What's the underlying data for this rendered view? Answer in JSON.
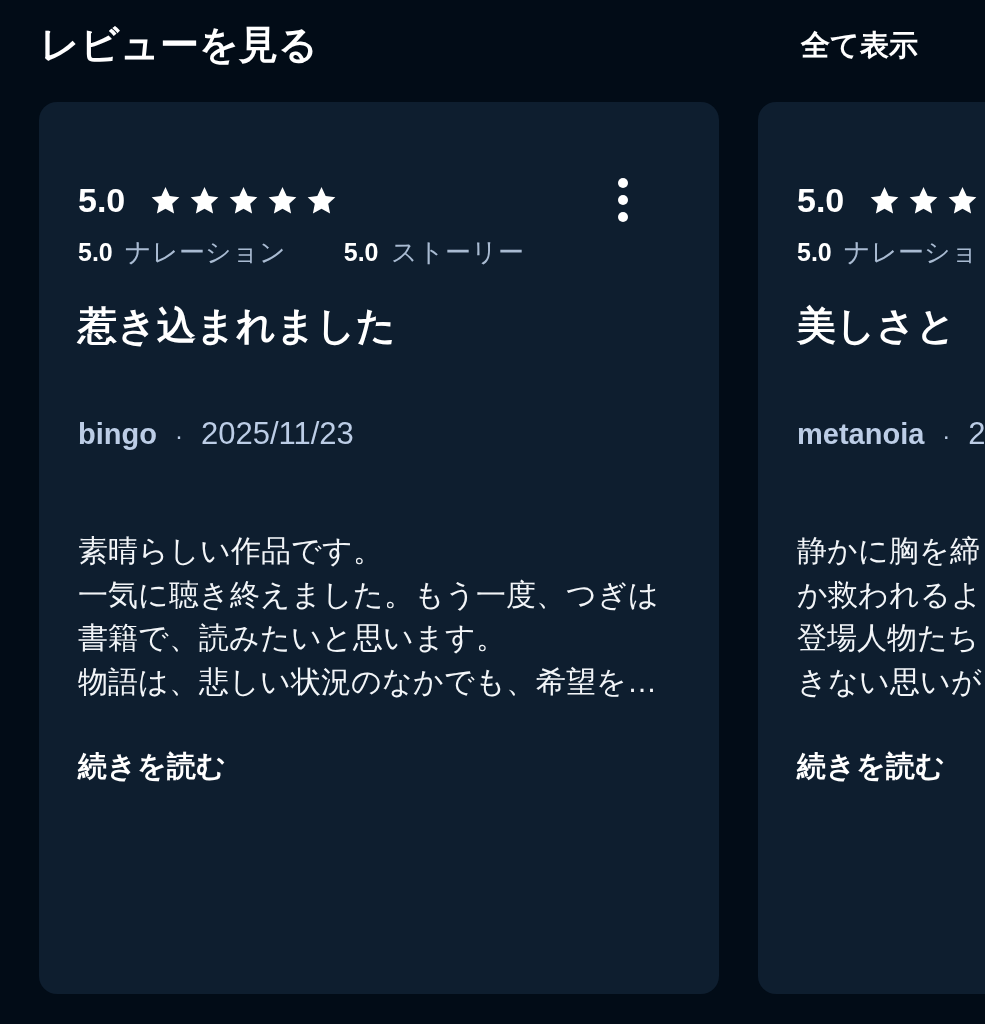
{
  "header": {
    "title": "レビューを見る",
    "see_all": "全て表示"
  },
  "reviews": [
    {
      "rating": "5.0",
      "stars": 5,
      "more_menu": true,
      "sub_ratings": [
        {
          "score": "5.0",
          "label": "ナレーション"
        },
        {
          "score": "5.0",
          "label": "ストーリー"
        }
      ],
      "title": "惹き込まれました",
      "author": "bingo",
      "separator": "·",
      "date": "2025/11/23",
      "body": [
        "素晴らしい作品です。",
        "一気に聴き終えました。もう一度、つぎは書籍で、読みたいと思います。",
        "物語は、悲しい状況のなかでも、希望を…"
      ],
      "read_more": "続きを読む"
    },
    {
      "rating": "5.0",
      "stars": 3,
      "more_menu": false,
      "sub_ratings": [
        {
          "score": "5.0",
          "label": "ナレーショ"
        }
      ],
      "title": "美しさと",
      "author": "metanoia",
      "separator": "·",
      "date": "2",
      "body": [
        "静かに胸を締",
        "か救われるよ",
        "登場人物たち",
        "きない思いが"
      ],
      "read_more": "続きを読む"
    }
  ]
}
